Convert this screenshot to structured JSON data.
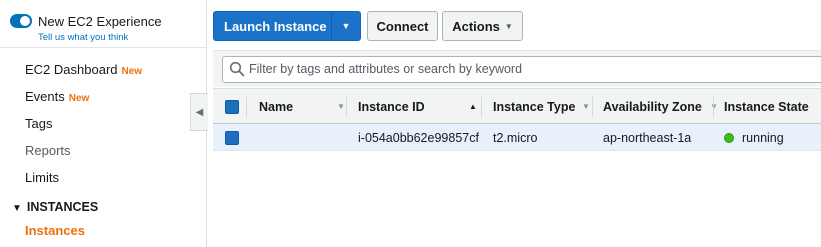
{
  "sidebar": {
    "experience_title": "New EC2 Experience",
    "experience_link": "Tell us what you think",
    "items": [
      {
        "label": "EC2 Dashboard",
        "badge": "New"
      },
      {
        "label": "Events",
        "badge": "New"
      },
      {
        "label": "Tags"
      },
      {
        "label": "Reports"
      },
      {
        "label": "Limits"
      }
    ],
    "section_label": "INSTANCES",
    "active_item": "Instances"
  },
  "toolbar": {
    "launch_label": "Launch Instance",
    "connect_label": "Connect",
    "actions_label": "Actions"
  },
  "filter": {
    "placeholder": "Filter by tags and attributes or search by keyword"
  },
  "table": {
    "columns": [
      "Name",
      "Instance ID",
      "Instance Type",
      "Availability Zone",
      "Instance State"
    ],
    "rows": [
      {
        "name": "",
        "instance_id": "i-054a0bb62e99857cf",
        "instance_type": "t2.micro",
        "availability_zone": "ap-northeast-1a",
        "instance_state": "running"
      }
    ]
  },
  "colors": {
    "accent": "#0073bb",
    "primary_button": "#1a73c9",
    "new_badge": "#ec7211",
    "running": "#3fbb1e"
  }
}
